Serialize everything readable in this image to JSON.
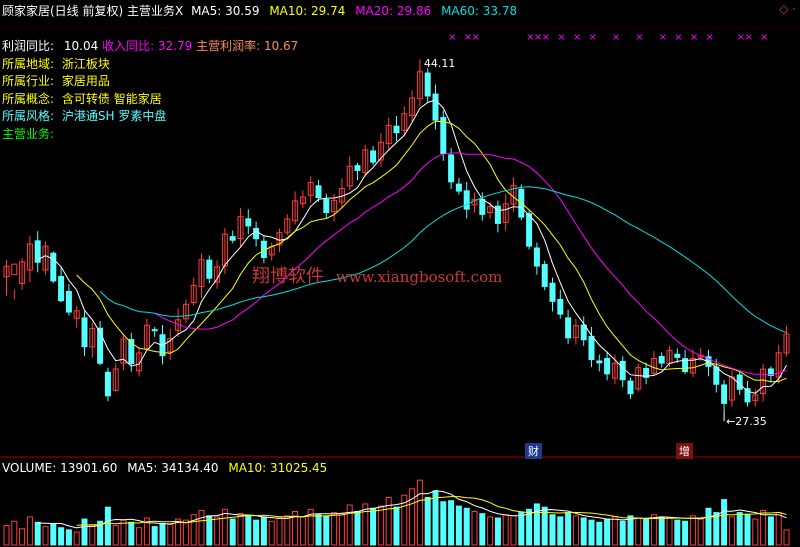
{
  "header": {
    "title": "顾家家居(日线 前复权) 主营业务",
    "close_mark": "X",
    "ma5": "MA5: 30.59",
    "ma10": "MA10: 29.74",
    "ma20": "MA20: 29.86",
    "ma60": "MA60: 33.78"
  },
  "info": {
    "profit_yoy_label": "利润同比:",
    "profit_yoy_value": "10.04",
    "revenue_yoy": "收入同比: 32.79",
    "main_margin": "主营利润率: 10.67",
    "region_label": "所属地域:",
    "region_value": "浙江板块",
    "industry_label": "所属行业:",
    "industry_value": "家居用品",
    "concept_label": "所属概念:",
    "concept_value": "含可转债 智能家居",
    "style_label": "所属风格:",
    "style_value": "沪港通SH 罗素中盘",
    "business_label": "主营业务:"
  },
  "watermark": {
    "cn": "翔博软件",
    "url": "www.xiangbosoft.com"
  },
  "annotations": {
    "high": "44.11",
    "low": "27.35",
    "tag_cai": "财",
    "tag_zeng": "增"
  },
  "volume_header": {
    "volume": "VOLUME: 13901.60",
    "ma5": "MA5: 34134.40",
    "ma10": "MA10: 31025.45"
  },
  "colors": {
    "up": "#ff3c3c",
    "down": "#54ffff",
    "ma5": "#ffffff",
    "ma10": "#ffff00",
    "ma20": "#ff00ff",
    "ma60": "#00e0e0",
    "separator": "#b00000",
    "text_default": "#ffffff",
    "label_yellow": "#ffff00",
    "label_cyan": "#54ffff",
    "label_green": "#00ff00",
    "label_magenta": "#ff00ff",
    "label_orange": "#ff8c5a"
  },
  "chart_data": {
    "type": "candlestick",
    "price_range": [
      25.5,
      45.5
    ],
    "high_value": 44.11,
    "low_value": 27.35,
    "candles": [
      [
        33.75,
        34.25,
        32.84,
        34.55
      ],
      [
        33.85,
        34.35,
        32.67,
        33.15
      ],
      [
        33.43,
        34.46,
        33.12,
        34.64
      ],
      [
        34.07,
        35.31,
        33.48,
        35.69
      ],
      [
        35.46,
        34.44,
        33.96,
        35.92
      ],
      [
        34.07,
        35.21,
        33.85,
        35.44
      ],
      [
        34.87,
        33.55,
        33.44,
        34.95
      ],
      [
        33.76,
        32.61,
        32.54,
        34.21
      ],
      [
        33.05,
        32.07,
        31.91,
        33.4
      ],
      [
        31.77,
        32.13,
        31.32,
        32.37
      ],
      [
        31.79,
        30.42,
        29.98,
        32.11
      ],
      [
        30.41,
        31.28,
        29.9,
        31.58
      ],
      [
        31.3,
        29.63,
        29.54,
        31.64
      ],
      [
        29.2,
        28.08,
        27.82,
        29.42
      ],
      [
        28.34,
        29.36,
        28.28,
        29.62
      ],
      [
        29.63,
        30.78,
        29.31,
        31.05
      ],
      [
        30.76,
        29.62,
        29.23,
        31.08
      ],
      [
        29.27,
        30.12,
        29.0,
        30.41
      ],
      [
        30.32,
        31.44,
        30.26,
        31.75
      ],
      [
        31.23,
        31.18,
        30.89,
        31.36
      ],
      [
        30.99,
        29.99,
        29.58,
        31.45
      ],
      [
        30.17,
        30.81,
        29.77,
        31.26
      ],
      [
        31.2,
        31.7,
        30.88,
        32.24
      ],
      [
        31.75,
        32.44,
        31.54,
        32.67
      ],
      [
        32.52,
        33.34,
        32.37,
        33.71
      ],
      [
        33.28,
        34.56,
        32.74,
        34.87
      ],
      [
        34.54,
        33.68,
        33.43,
        34.76
      ],
      [
        33.49,
        34.22,
        33.18,
        34.53
      ],
      [
        34.26,
        35.78,
        33.89,
        36.07
      ],
      [
        35.66,
        35.49,
        35.34,
        35.95
      ],
      [
        35.57,
        36.61,
        35.15,
        37.03
      ],
      [
        36.51,
        36.17,
        35.77,
        36.96
      ],
      [
        36.05,
        35.56,
        35.19,
        36.38
      ],
      [
        35.44,
        34.67,
        34.39,
        35.73
      ],
      [
        34.79,
        35.18,
        34.51,
        35.38
      ],
      [
        35.27,
        35.85,
        34.92,
        36.04
      ],
      [
        35.87,
        36.5,
        35.74,
        36.73
      ],
      [
        36.42,
        37.36,
        36.23,
        37.81
      ],
      [
        37.23,
        37.55,
        37.01,
        37.86
      ],
      [
        37.63,
        38.24,
        37.25,
        38.53
      ],
      [
        38.08,
        37.52,
        37.31,
        38.37
      ],
      [
        37.43,
        36.81,
        36.55,
        37.71
      ],
      [
        36.85,
        37.39,
        36.38,
        37.69
      ],
      [
        37.31,
        37.95,
        37.02,
        38.44
      ],
      [
        38.07,
        39.01,
        37.87,
        39.48
      ],
      [
        39.04,
        38.81,
        38.35,
        39.17
      ],
      [
        38.72,
        39.79,
        38.53,
        40.04
      ],
      [
        39.74,
        39.21,
        39.06,
        39.98
      ],
      [
        39.31,
        40.15,
        39.0,
        40.6
      ],
      [
        40.09,
        40.96,
        39.79,
        41.32
      ],
      [
        40.92,
        40.61,
        40.21,
        41.41
      ],
      [
        40.72,
        41.51,
        40.44,
        41.86
      ],
      [
        41.43,
        42.26,
        41.13,
        42.63
      ],
      [
        42.23,
        43.51,
        41.87,
        44.11
      ],
      [
        43.45,
        42.36,
        42.08,
        43.68
      ],
      [
        42.45,
        41.21,
        40.76,
        42.9
      ],
      [
        41.33,
        39.62,
        39.27,
        41.67
      ],
      [
        39.55,
        38.27,
        37.93,
        39.88
      ],
      [
        38.16,
        37.83,
        37.67,
        38.45
      ],
      [
        37.84,
        36.97,
        36.53,
        38.27
      ],
      [
        37.17,
        37.42,
        36.81,
        37.76
      ],
      [
        37.43,
        36.72,
        36.42,
        37.77
      ],
      [
        36.81,
        37.09,
        36.51,
        37.33
      ],
      [
        37.11,
        36.29,
        35.86,
        37.38
      ],
      [
        36.34,
        37.22,
        35.94,
        37.68
      ],
      [
        37.21,
        38.1,
        36.85,
        38.48
      ],
      [
        37.91,
        36.59,
        36.44,
        38.15
      ],
      [
        36.75,
        35.21,
        35.05,
        36.9
      ],
      [
        35.12,
        34.26,
        33.85,
        35.38
      ],
      [
        34.33,
        33.29,
        33.11,
        34.51
      ],
      [
        33.44,
        32.58,
        32.1,
        33.71
      ],
      [
        32.67,
        31.97,
        31.75,
        33.13
      ],
      [
        31.79,
        30.84,
        30.55,
        32.18
      ],
      [
        30.86,
        31.42,
        30.52,
        31.74
      ],
      [
        31.45,
        30.75,
        30.46,
        31.86
      ],
      [
        30.91,
        29.81,
        29.45,
        31.36
      ],
      [
        29.74,
        29.65,
        29.24,
        30.04
      ],
      [
        29.86,
        29.13,
        28.82,
        30.19
      ],
      [
        28.92,
        29.63,
        28.63,
        30.05
      ],
      [
        29.72,
        28.85,
        28.5,
        29.96
      ],
      [
        28.78,
        28.18,
        27.94,
        28.94
      ],
      [
        28.41,
        29.42,
        28.28,
        29.61
      ],
      [
        29.38,
        28.96,
        28.63,
        29.67
      ],
      [
        29.16,
        29.86,
        29.03,
        30.21
      ],
      [
        29.95,
        29.64,
        29.42,
        30.15
      ],
      [
        29.63,
        30.23,
        29.45,
        30.47
      ],
      [
        30.06,
        29.91,
        29.65,
        30.34
      ],
      [
        29.85,
        29.23,
        29.12,
        30.27
      ],
      [
        29.17,
        29.86,
        28.97,
        30.29
      ],
      [
        29.92,
        30.01,
        29.74,
        30.37
      ],
      [
        29.94,
        29.48,
        29.01,
        30.27
      ],
      [
        29.45,
        28.63,
        28.24,
        29.84
      ],
      [
        28.6,
        27.72,
        27.35,
        28.84
      ],
      [
        27.88,
        28.98,
        27.56,
        29.28
      ],
      [
        29.07,
        28.39,
        28.13,
        29.27
      ],
      [
        28.42,
        27.79,
        27.57,
        28.78
      ],
      [
        27.85,
        28.12,
        27.57,
        28.39
      ],
      [
        28.19,
        29.35,
        27.81,
        29.62
      ],
      [
        29.36,
        29.05,
        28.72,
        29.48
      ],
      [
        28.97,
        30.13,
        28.65,
        30.51
      ],
      [
        30.12,
        31.02,
        29.95,
        31.41
      ]
    ],
    "volume_range": [
      0,
      62000
    ],
    "volumes": [
      18000,
      22000,
      15000,
      26000,
      21000,
      17000,
      20000,
      16000,
      14000,
      12000,
      24000,
      19000,
      22000,
      35000,
      18000,
      23000,
      21000,
      16000,
      25000,
      17000,
      20000,
      19000,
      24000,
      23000,
      28000,
      32000,
      27000,
      26000,
      33000,
      24000,
      29000,
      27000,
      23000,
      26000,
      22000,
      25000,
      27000,
      31000,
      26000,
      33000,
      28000,
      27000,
      30000,
      29000,
      37000,
      31000,
      38000,
      34000,
      36000,
      44000,
      35000,
      46000,
      52000,
      60000,
      44000,
      50000,
      40000,
      41000,
      36000,
      34000,
      31000,
      29000,
      26000,
      25000,
      28000,
      27000,
      30000,
      33000,
      38000,
      35000,
      28000,
      26000,
      30000,
      27000,
      25000,
      23000,
      21000,
      24000,
      26000,
      22000,
      27000,
      25000,
      24000,
      28000,
      26000,
      25000,
      23000,
      22000,
      27000,
      24000,
      34000,
      30000,
      42000,
      26000,
      30000,
      28000,
      24000,
      32000,
      26000,
      30000,
      13900
    ]
  }
}
